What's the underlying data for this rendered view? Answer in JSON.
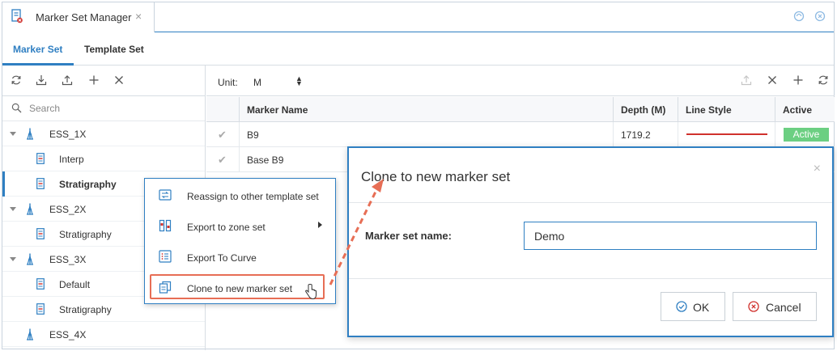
{
  "window": {
    "tab_title": "Marker Set Manager",
    "tab_close": "×"
  },
  "subtabs": [
    {
      "label": "Marker Set",
      "active": true
    },
    {
      "label": "Template Set",
      "active": false
    }
  ],
  "left": {
    "search_placeholder": "Search",
    "tree": [
      {
        "label": "ESS_1X",
        "type": "well",
        "expanded": true
      },
      {
        "label": "Interp",
        "type": "set"
      },
      {
        "label": "Stratigraphy",
        "type": "set",
        "selected": true
      },
      {
        "label": "ESS_2X",
        "type": "well",
        "expanded": true
      },
      {
        "label": "Stratigraphy",
        "type": "set"
      },
      {
        "label": "ESS_3X",
        "type": "well",
        "expanded": true
      },
      {
        "label": "Default",
        "type": "set"
      },
      {
        "label": "Stratigraphy",
        "type": "set"
      },
      {
        "label": "ESS_4X",
        "type": "well",
        "expanded": false
      }
    ]
  },
  "right": {
    "unit_label": "Unit:",
    "unit_value": "M",
    "columns": [
      "Marker Name",
      "Depth (M)",
      "Line Style",
      "Active"
    ],
    "rows": [
      {
        "name": "B9",
        "depth": "1719.2",
        "line_color": "#d0312d",
        "active": "Active"
      },
      {
        "name": "Base B9",
        "depth": "",
        "line_color": "",
        "active": ""
      }
    ]
  },
  "context_menu": {
    "items": [
      {
        "label": "Reassign to other template set",
        "icon": "reassign-icon"
      },
      {
        "label": "Export to zone set",
        "icon": "zone-export-icon",
        "submenu": true
      },
      {
        "label": "Export To Curve",
        "icon": "list-icon"
      },
      {
        "label": "Clone to new marker set",
        "icon": "clone-icon",
        "highlighted": true
      }
    ]
  },
  "dialog": {
    "title": "Clone to new marker set",
    "close": "×",
    "field_label": "Marker set name:",
    "field_value": "Demo",
    "ok_label": "OK",
    "cancel_label": "Cancel"
  },
  "colors": {
    "accent": "#2f7fc2",
    "highlight": "#e76e55",
    "active_badge": "#6ccf82",
    "line_red": "#d0312d"
  }
}
